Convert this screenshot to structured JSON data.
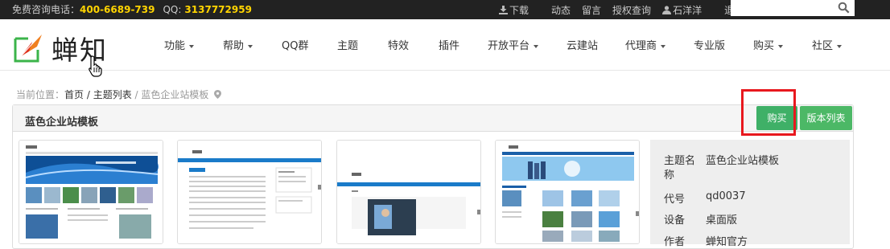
{
  "topbar": {
    "hotline_label": "免费咨询电话：",
    "hotline_number": "400-6689-739",
    "qq_label": "QQ:",
    "qq_number": "3137772959",
    "links": [
      "下载",
      "动态",
      "留言",
      "授权查询",
      "石洋洋",
      "退出"
    ]
  },
  "search": {
    "placeholder": ""
  },
  "logo": {
    "text": "蝉知"
  },
  "nav": {
    "items": [
      {
        "label": "功能",
        "dropdown": true
      },
      {
        "label": "帮助",
        "dropdown": true
      },
      {
        "label": "QQ群",
        "dropdown": false
      },
      {
        "label": "主题",
        "dropdown": false
      },
      {
        "label": "特效",
        "dropdown": false
      },
      {
        "label": "插件",
        "dropdown": false
      },
      {
        "label": "开放平台",
        "dropdown": true
      },
      {
        "label": "云建站",
        "dropdown": false
      },
      {
        "label": "代理商",
        "dropdown": true
      },
      {
        "label": "专业版",
        "dropdown": false
      },
      {
        "label": "购买",
        "dropdown": true
      },
      {
        "label": "社区",
        "dropdown": true
      }
    ]
  },
  "breadcrumb": {
    "prefix": "当前位置：",
    "home": "首页",
    "sep1": " / ",
    "list": "主题列表",
    "sep2": " / ",
    "current": "蓝色企业站模板"
  },
  "panel": {
    "title": "蓝色企业站模板",
    "buy_label": "购买",
    "versions_label": "版本列表"
  },
  "info": {
    "rows": [
      {
        "key": "主题名称",
        "value": "蓝色企业站模板"
      },
      {
        "key": "代号",
        "value": "qd0037"
      },
      {
        "key": "设备",
        "value": "桌面版"
      },
      {
        "key": "作者",
        "value": "蝉知官方"
      }
    ]
  },
  "colors": {
    "topbar": "#222222",
    "highlight": "#ffd400",
    "green": "#3fb067",
    "red_box": "#e8181e"
  }
}
